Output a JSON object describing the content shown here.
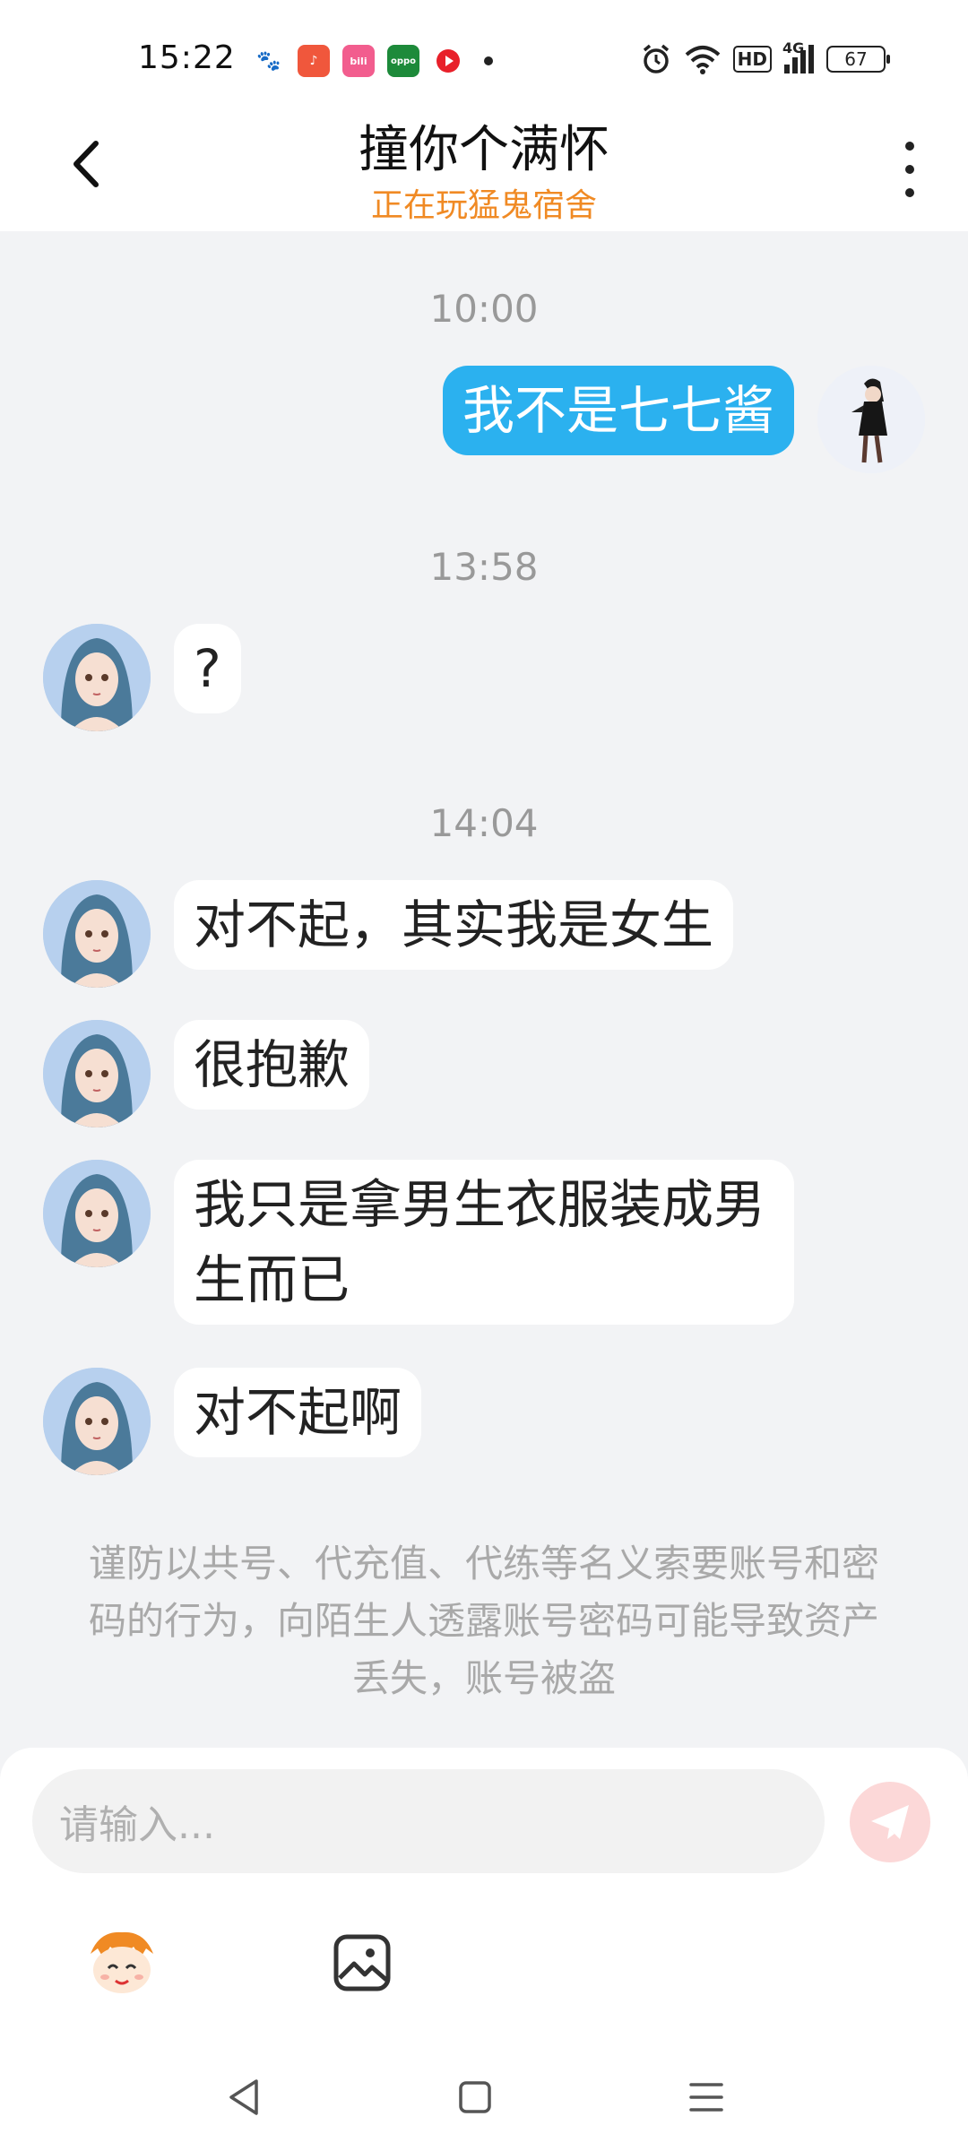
{
  "status_bar": {
    "time": "15:22",
    "battery": "67",
    "hd": "HD",
    "network": "4G",
    "app_icons": [
      "baidu-icon",
      "music-icon",
      "bilibili-icon",
      "oppo-icon",
      "video-icon"
    ],
    "system_icons": [
      "alarm-icon",
      "wifi-icon",
      "hd-icon",
      "signal-icon",
      "battery-icon"
    ]
  },
  "header": {
    "title": "撞你个满怀",
    "subtitle": "正在玩猛鬼宿舍",
    "accent_color": "#f08a24"
  },
  "messages": [
    {
      "type": "time",
      "text": "10:00"
    },
    {
      "type": "out",
      "text": "我不是七七酱"
    },
    {
      "type": "time",
      "text": "13:58"
    },
    {
      "type": "in",
      "text": "?"
    },
    {
      "type": "time",
      "text": "14:04"
    },
    {
      "type": "in",
      "text": "对不起，其实我是女生"
    },
    {
      "type": "in",
      "text": "很抱歉"
    },
    {
      "type": "in",
      "text": "我只是拿男生衣服装成男生而已"
    },
    {
      "type": "in",
      "text": "对不起啊"
    }
  ],
  "notice": "谨防以共号、代充值、代练等名义索要账号和密码的行为，向陌生人透露账号密码可能导致资产丢失，账号被盗",
  "input": {
    "placeholder": "请输入..."
  },
  "colors": {
    "outgoing_bubble": "#2bb1ef",
    "incoming_bubble": "#ffffff",
    "background": "#f2f3f5",
    "send_button": "#fcd8d8"
  }
}
